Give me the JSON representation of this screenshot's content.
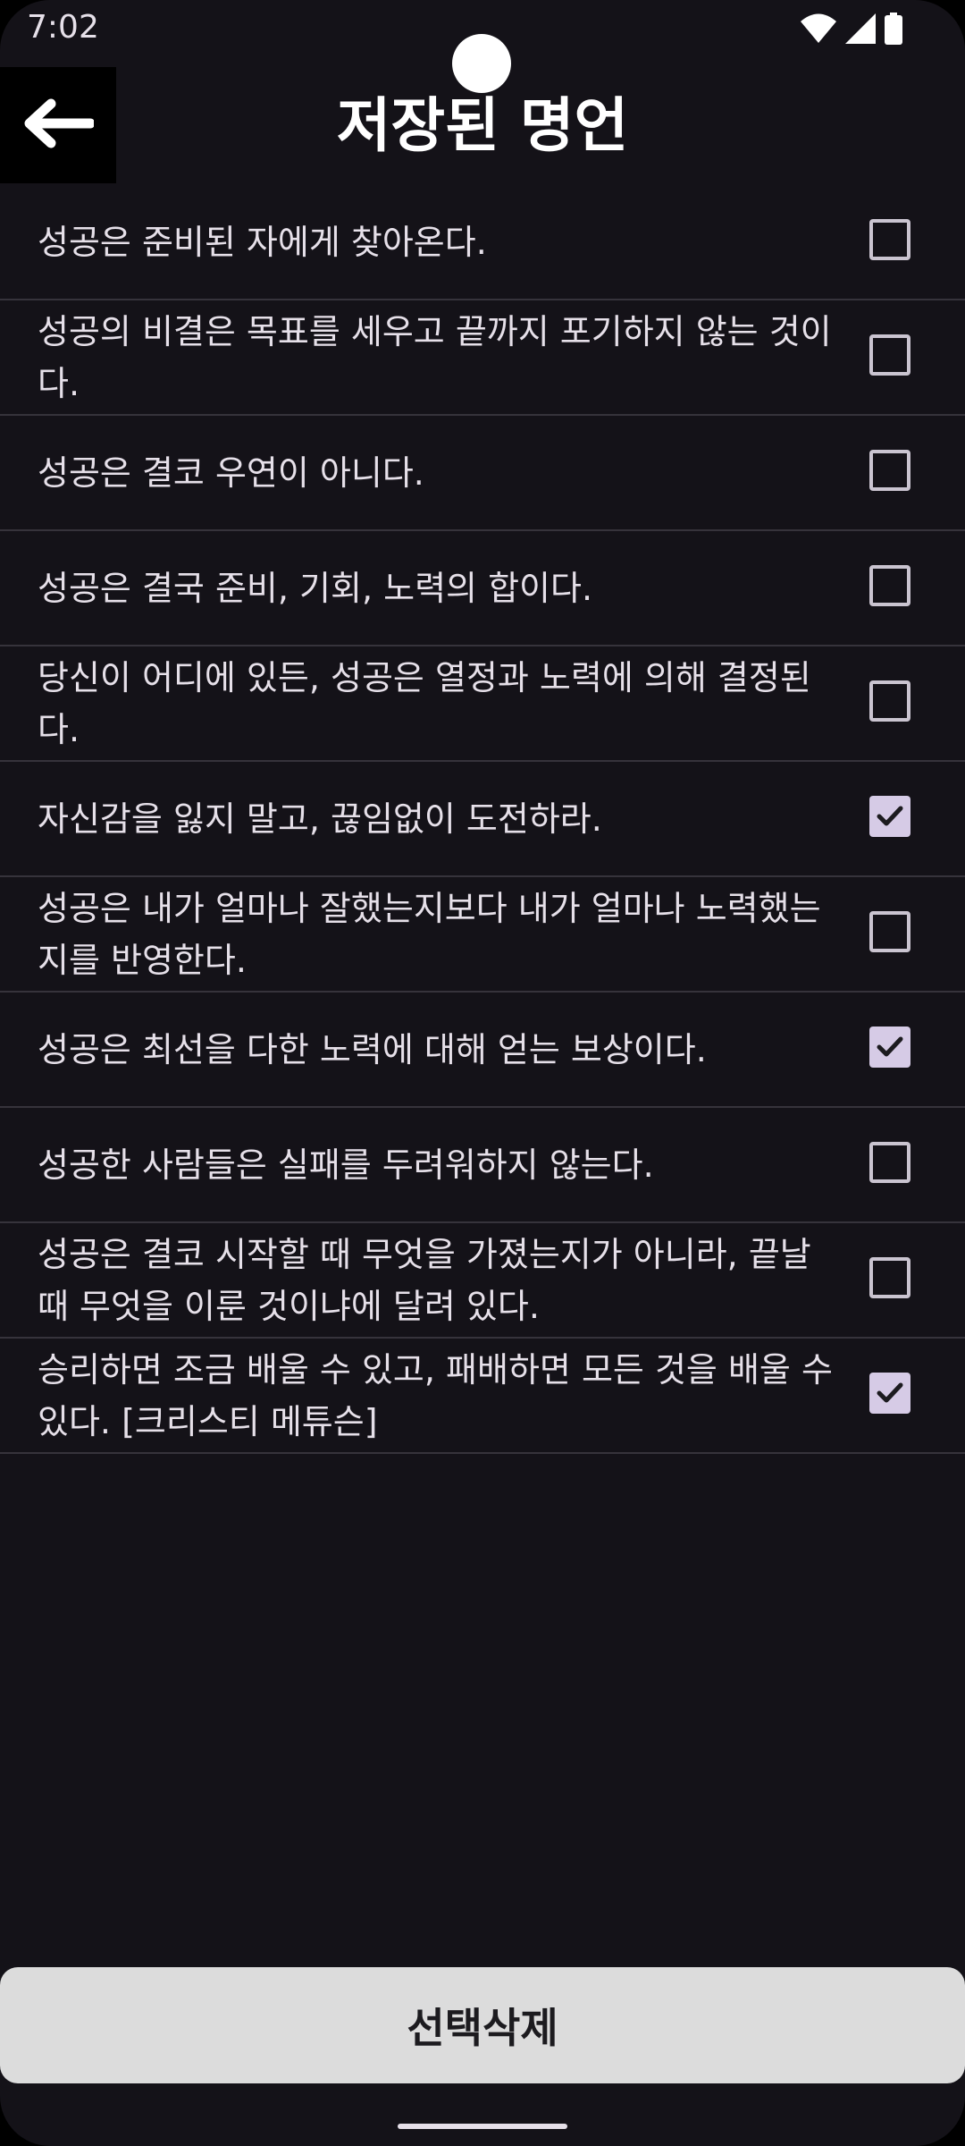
{
  "status_bar": {
    "time": "7:02",
    "icons": [
      "wifi-icon",
      "signal-icon",
      "battery-icon"
    ]
  },
  "app_bar": {
    "back_icon": "arrow-left-icon",
    "title": "저장된 명언"
  },
  "quotes": [
    {
      "text": "성공은 준비된 자에게 찾아온다.",
      "checked": false
    },
    {
      "text": "성공의 비결은 목표를 세우고 끝까지 포기하지 않는 것이다.",
      "checked": false
    },
    {
      "text": "성공은 결코 우연이 아니다.",
      "checked": false
    },
    {
      "text": "성공은 결국 준비, 기회, 노력의 합이다.",
      "checked": false
    },
    {
      "text": "당신이 어디에 있든, 성공은 열정과 노력에 의해 결정된다.",
      "checked": false
    },
    {
      "text": "자신감을 잃지 말고, 끊임없이 도전하라.",
      "checked": true
    },
    {
      "text": "성공은 내가 얼마나 잘했는지보다 내가 얼마나 노력했는지를 반영한다.",
      "checked": false
    },
    {
      "text": "성공은 최선을 다한 노력에 대해 얻는 보상이다.",
      "checked": true
    },
    {
      "text": "성공한 사람들은 실패를 두려워하지 않는다.",
      "checked": false
    },
    {
      "text": "성공은 결코 시작할 때 무엇을 가졌는지가 아니라, 끝날 때 무엇을 이룬 것이냐에 달려 있다.",
      "checked": false
    },
    {
      "text": "승리하면 조금 배울 수 있고, 패배하면 모든 것을 배울 수 있다. [크리스티 메튜슨]",
      "checked": true
    }
  ],
  "footer": {
    "delete_label": "선택삭제"
  },
  "colors": {
    "background": "#141218",
    "checkbox_checked": "#d6cbe6",
    "divider": "#36333b",
    "button_bg": "#dcdcdc"
  }
}
